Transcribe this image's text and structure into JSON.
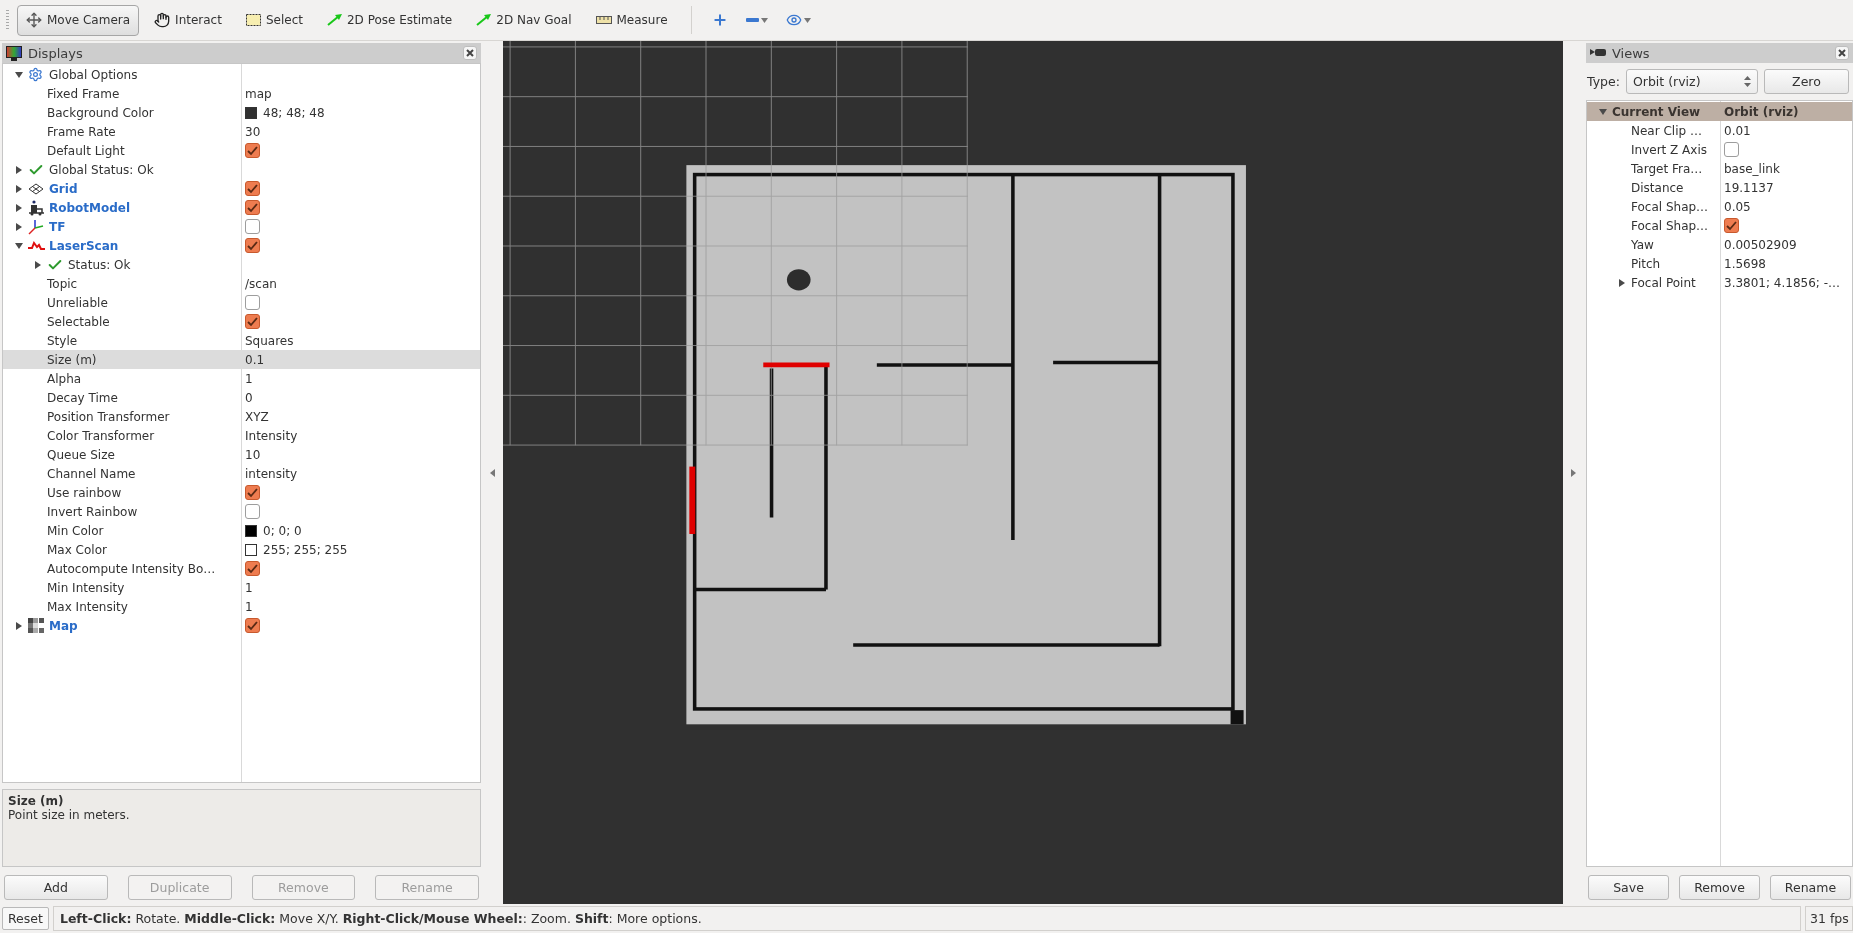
{
  "toolbar": {
    "tools": [
      {
        "label": "Move Camera",
        "selected": true
      },
      {
        "label": "Interact",
        "selected": false
      },
      {
        "label": "Select",
        "selected": false
      },
      {
        "label": "2D Pose Estimate",
        "selected": false
      },
      {
        "label": "2D Nav Goal",
        "selected": false
      },
      {
        "label": "Measure",
        "selected": false
      }
    ]
  },
  "displays": {
    "title": "Displays",
    "items": [
      {
        "label": "Global Options",
        "kind": "options",
        "expanded": true,
        "selected": false,
        "children": [
          {
            "label": "Fixed Frame",
            "kind": "text",
            "value": "map",
            "selected": false
          },
          {
            "label": "Background Color",
            "kind": "color",
            "value": "48; 48; 48",
            "color": "#303030",
            "selected": false
          },
          {
            "label": "Frame Rate",
            "kind": "text",
            "value": "30",
            "selected": false
          },
          {
            "label": "Default Light",
            "kind": "checkbox",
            "checked": true,
            "selected": false
          }
        ]
      },
      {
        "label": "Global Status: Ok",
        "kind": "status",
        "expanded": false,
        "selected": false
      },
      {
        "label": "Grid",
        "kind": "display",
        "expanded": false,
        "checked": true,
        "selected": false
      },
      {
        "label": "RobotModel",
        "kind": "display",
        "expanded": false,
        "checked": true,
        "selected": false
      },
      {
        "label": "TF",
        "kind": "display",
        "expanded": false,
        "checked": false,
        "selected": false
      },
      {
        "label": "LaserScan",
        "kind": "display",
        "expanded": true,
        "checked": true,
        "selected": false,
        "children": [
          {
            "label": "Status: Ok",
            "kind": "status",
            "expanded": false,
            "selected": false
          },
          {
            "label": "Topic",
            "kind": "text",
            "value": "/scan",
            "selected": false
          },
          {
            "label": "Unreliable",
            "kind": "checkbox",
            "checked": false,
            "selected": false
          },
          {
            "label": "Selectable",
            "kind": "checkbox",
            "checked": true,
            "selected": false
          },
          {
            "label": "Style",
            "kind": "text",
            "value": "Squares",
            "selected": false
          },
          {
            "label": "Size (m)",
            "kind": "text",
            "value": "0.1",
            "selected": true
          },
          {
            "label": "Alpha",
            "kind": "text",
            "value": "1",
            "selected": false
          },
          {
            "label": "Decay Time",
            "kind": "text",
            "value": "0",
            "selected": false
          },
          {
            "label": "Position Transformer",
            "kind": "text",
            "value": "XYZ",
            "selected": false
          },
          {
            "label": "Color Transformer",
            "kind": "text",
            "value": "Intensity",
            "selected": false
          },
          {
            "label": "Queue Size",
            "kind": "text",
            "value": "10",
            "selected": false
          },
          {
            "label": "Channel Name",
            "kind": "text",
            "value": "intensity",
            "selected": false
          },
          {
            "label": "Use rainbow",
            "kind": "checkbox",
            "checked": true,
            "selected": false
          },
          {
            "label": "Invert Rainbow",
            "kind": "checkbox",
            "checked": false,
            "selected": false
          },
          {
            "label": "Min Color",
            "kind": "color",
            "value": "0; 0; 0",
            "color": "#000000",
            "selected": false
          },
          {
            "label": "Max Color",
            "kind": "color",
            "value": "255; 255; 255",
            "color": "#ffffff",
            "selected": false
          },
          {
            "label": "Autocompute Intensity Bo…",
            "kind": "checkbox",
            "checked": true,
            "selected": false
          },
          {
            "label": "Min Intensity",
            "kind": "text",
            "value": "1",
            "selected": false
          },
          {
            "label": "Max Intensity",
            "kind": "text",
            "value": "1",
            "selected": false
          }
        ]
      },
      {
        "label": "Map",
        "kind": "display",
        "expanded": false,
        "checked": true,
        "selected": false
      }
    ],
    "description": {
      "title": "Size (m)",
      "text": "Point size in meters."
    },
    "buttons": [
      {
        "label": "Add",
        "disabled": false
      },
      {
        "label": "Duplicate",
        "disabled": true
      },
      {
        "label": "Remove",
        "disabled": true
      },
      {
        "label": "Rename",
        "disabled": true
      }
    ]
  },
  "views": {
    "title": "Views",
    "type_label": "Type:",
    "type_value": "Orbit (rviz)",
    "zero_button": "Zero",
    "items": [
      {
        "label": "Current View",
        "kind": "header",
        "value": "Orbit (rviz)",
        "expanded": true,
        "selected": false,
        "children": [
          {
            "label": "Near Clip …",
            "kind": "text",
            "value": "0.01",
            "selected": false
          },
          {
            "label": "Invert Z Axis",
            "kind": "checkbox",
            "checked": false,
            "selected": false
          },
          {
            "label": "Target Fra…",
            "kind": "text",
            "value": "base_link",
            "selected": false
          },
          {
            "label": "Distance",
            "kind": "text",
            "value": "19.1137",
            "selected": false
          },
          {
            "label": "Focal Shap…",
            "kind": "text",
            "value": "0.05",
            "selected": false
          },
          {
            "label": "Focal Shap…",
            "kind": "checkbox",
            "checked": true,
            "selected": false
          },
          {
            "label": "Yaw",
            "kind": "text",
            "value": "0.00502909",
            "selected": false
          },
          {
            "label": "Pitch",
            "kind": "text",
            "value": "1.5698",
            "selected": false
          },
          {
            "label": "Focal Point",
            "kind": "text",
            "value": "3.3801; 4.1856; -…",
            "expanded": false,
            "selected": false
          }
        ]
      }
    ],
    "buttons": [
      "Save",
      "Remove",
      "Rename"
    ]
  },
  "status_bar": {
    "reset": "Reset",
    "hint": "**Left-Click:** Rotate. **Middle-Click:** Move X/Y. **Right-Click/Mouse Wheel:**: Zoom. **Shift**: More options.",
    "fps": "31 fps"
  }
}
